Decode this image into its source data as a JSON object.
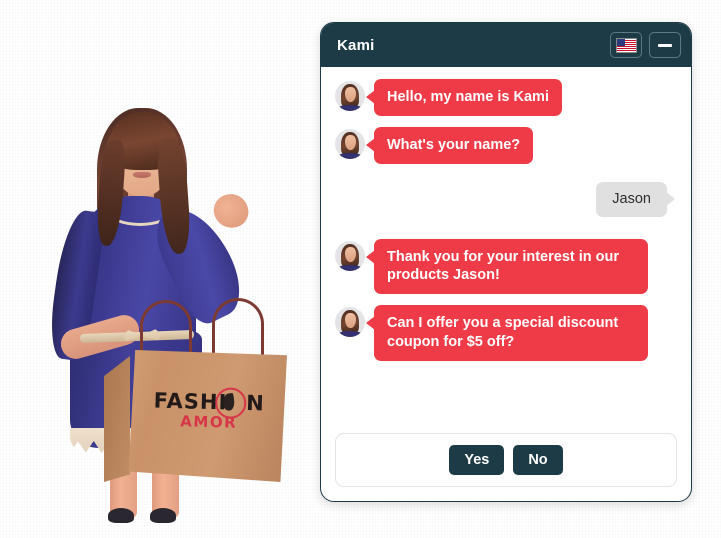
{
  "widget": {
    "header": {
      "title": "Kami",
      "language_button_icon": "us-flag-icon",
      "minimize_button_icon": "minimize-icon"
    },
    "messages": [
      {
        "sender": "bot",
        "text": "Hello, my name is Kami"
      },
      {
        "sender": "bot",
        "text": "What's your name?"
      },
      {
        "sender": "user",
        "text": "Jason"
      },
      {
        "sender": "bot",
        "text": "Thank you for your interest in our products Jason!"
      },
      {
        "sender": "bot",
        "text": "Can I offer you a special discount coupon for $5 off?"
      }
    ],
    "quick_replies": [
      {
        "label": "Yes"
      },
      {
        "label": "No"
      }
    ]
  },
  "character": {
    "shopping_bag": {
      "logo_main": "FASHI",
      "logo_main_end": "N",
      "logo_sub": "AMOR"
    }
  },
  "colors": {
    "header_bg": "#1c3b47",
    "bot_bubble": "#ef3b47",
    "user_bubble": "#e0e0e0",
    "button_bg": "#1c3b47",
    "logo_red": "#d6354a"
  }
}
